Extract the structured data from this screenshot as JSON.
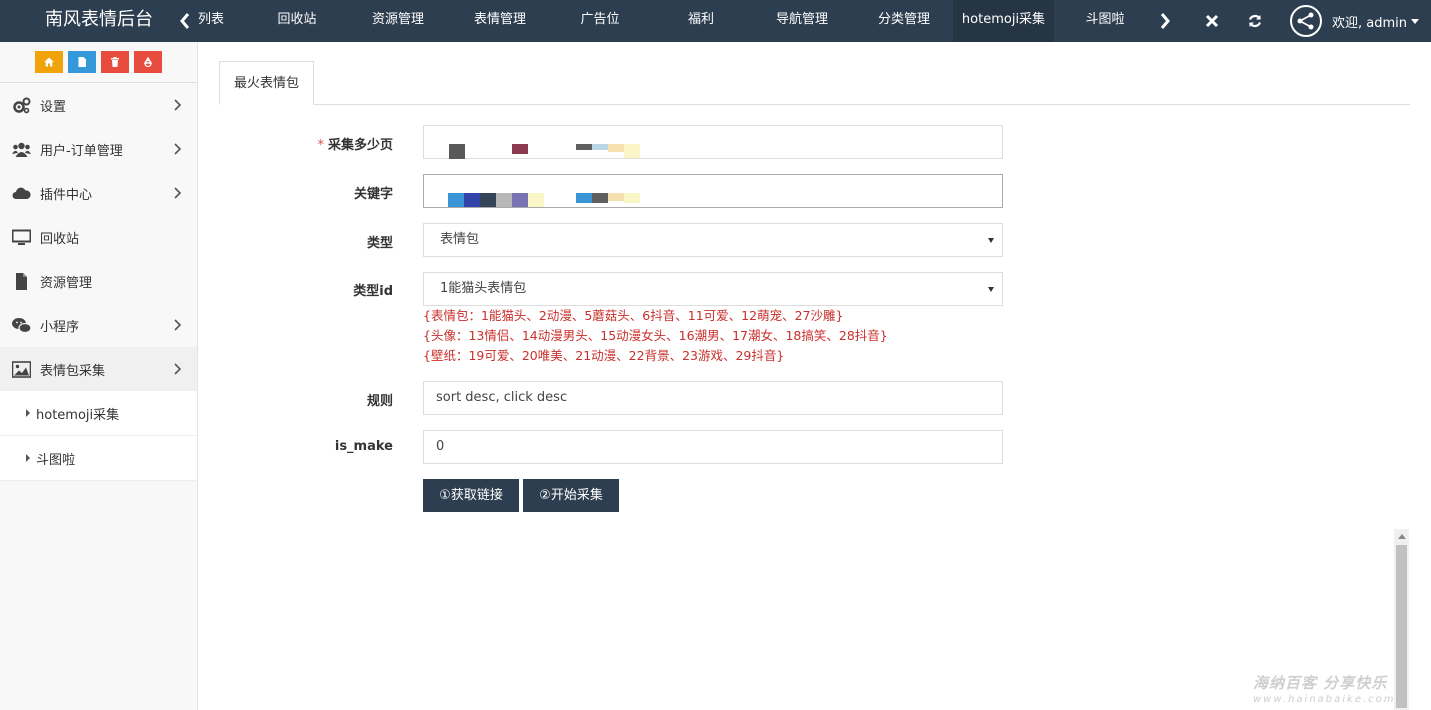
{
  "header": {
    "brand": "南风表情后台",
    "tabs": [
      {
        "label": "列表"
      },
      {
        "label": "回收站"
      },
      {
        "label": "资源管理"
      },
      {
        "label": "表情管理"
      },
      {
        "label": "广告位"
      },
      {
        "label": "福利"
      },
      {
        "label": "导航管理"
      },
      {
        "label": "分类管理"
      },
      {
        "label": "hotemoji采集",
        "active": true
      },
      {
        "label": "斗图啦"
      }
    ],
    "user_label": "欢迎, admin",
    "icons": [
      "chevron-left-icon",
      "chevron-right-icon",
      "close-icon",
      "refresh-icon",
      "share-icon"
    ],
    "colors": {
      "bar": "#2d3e50",
      "active_tab": "#253544"
    }
  },
  "shortcuts": [
    {
      "icon": "home-icon",
      "color": "#f0a30a"
    },
    {
      "icon": "file-icon",
      "color": "#3498db"
    },
    {
      "icon": "trash-icon",
      "color": "#e74c3c"
    },
    {
      "icon": "recycle-icon",
      "color": "#e74c3c"
    }
  ],
  "sidebar": {
    "items": [
      {
        "label": "设置",
        "icon": "gears-icon",
        "has_children": true
      },
      {
        "label": "用户-订单管理",
        "icon": "users-icon",
        "has_children": true
      },
      {
        "label": "插件中心",
        "icon": "cloud-icon",
        "has_children": true
      },
      {
        "label": "回收站",
        "icon": "monitor-icon",
        "has_children": false
      },
      {
        "label": "资源管理",
        "icon": "file-icon",
        "has_children": false
      },
      {
        "label": "小程序",
        "icon": "wechat-icon",
        "has_children": true
      },
      {
        "label": "表情包采集",
        "icon": "image-icon",
        "has_children": true,
        "open": true
      }
    ],
    "sub_items": [
      {
        "label": "hotemoji采集"
      },
      {
        "label": "斗图啦"
      }
    ]
  },
  "main": {
    "tab": "最火表情包",
    "fields": {
      "pages": {
        "label": "采集多少页",
        "required": "*"
      },
      "keyword": {
        "label": "关键字"
      },
      "type": {
        "label": "类型",
        "value": "表情包"
      },
      "type_id": {
        "label": "类型id",
        "value": "1能猫头表情包"
      },
      "rule": {
        "label": "规则",
        "value": "sort desc, click desc"
      },
      "is_make": {
        "label": "is_make",
        "value": "0"
      }
    },
    "hints": [
      "{表情包：1能猫头、2动漫、5蘑菇头、6抖音、11可爱、12萌宠、27沙雕}",
      "{头像：13情侣、14动漫男头、15动漫女头、16潮男、17潮女、18搞笑、28抖音}",
      "{壁纸：19可爱、20唯美、21动漫、22背景、23游戏、29抖音}"
    ],
    "buttons": {
      "get_links": "①获取链接",
      "start": "②开始采集"
    },
    "hint_color": "#c9302c"
  },
  "watermark": {
    "text": "海纳百客 分享快乐",
    "url": "www.hainabaike.com"
  }
}
